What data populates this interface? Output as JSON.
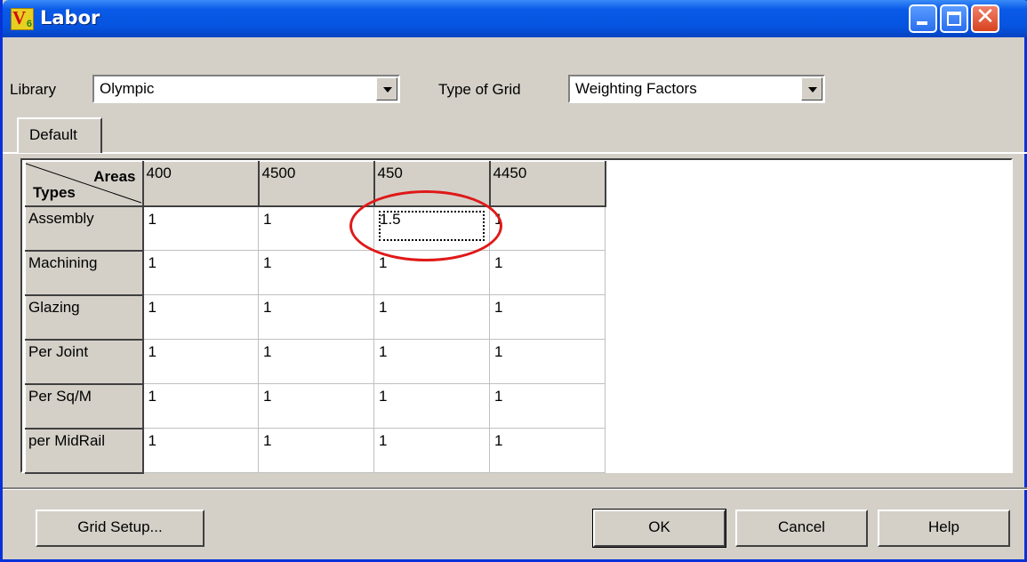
{
  "window": {
    "title": "Labor",
    "app_icon": "V6"
  },
  "toolbar": {
    "library_label": "Library",
    "library_value": "Olympic",
    "grid_type_label": "Type of Grid",
    "grid_type_value": "Weighting Factors"
  },
  "tabs": [
    {
      "label": "Default",
      "selected": true
    }
  ],
  "grid": {
    "corner_top": "Areas",
    "corner_bottom": "Types",
    "columns": [
      "400",
      "4500",
      "450",
      "4450"
    ],
    "rows": [
      {
        "label": "Assembly",
        "values": [
          "1",
          "1",
          "1.5",
          "1"
        ]
      },
      {
        "label": "Machining",
        "values": [
          "1",
          "1",
          "1",
          "1"
        ]
      },
      {
        "label": "Glazing",
        "values": [
          "1",
          "1",
          "1",
          "1"
        ]
      },
      {
        "label": "Per Joint",
        "values": [
          "1",
          "1",
          "1",
          "1"
        ]
      },
      {
        "label": "Per Sq/M",
        "values": [
          "1",
          "1",
          "1",
          "1"
        ]
      },
      {
        "label": "per MidRail",
        "values": [
          "1",
          "1",
          "1",
          "1"
        ]
      }
    ],
    "focused_cell": {
      "row": "Assembly",
      "column": "450"
    },
    "highlight_color": "#e01818"
  },
  "buttons": {
    "grid_setup": "Grid Setup...",
    "ok": "OK",
    "cancel": "Cancel",
    "help": "Help"
  },
  "colors": {
    "titlebar": "#0654e0",
    "face": "#d4d0c8",
    "close": "#d8421e"
  }
}
